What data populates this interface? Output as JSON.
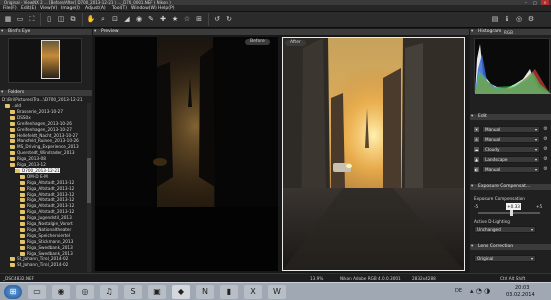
{
  "window": {
    "title": "Original - ViewNX 2 ...   [Before/After]  D700_2013-12-21 \\ ..._D70_0001.NEF  ( Nikon )"
  },
  "menu": {
    "items": [
      "File(F)",
      "Edit(E)",
      "View(V)",
      "Image(I)",
      "Adjust(A)",
      "Tool(T)",
      "Window(W)",
      "Help(P)"
    ]
  },
  "left": {
    "birds_eye_title": "Bird's Eye",
    "folders_title": "Folders",
    "path": "D:\\Bri\\Pictures\\Tra...\\D700_2013-12-21",
    "tree": [
      {
        "label": "..old",
        "indent": 1
      },
      {
        "label": "Brasserie_2013-10-27",
        "indent": 2
      },
      {
        "label": "DSS0x",
        "indent": 2
      },
      {
        "label": "Greifenhagen_2013-10-26",
        "indent": 2
      },
      {
        "label": "Greifenhagen_2013-10-27",
        "indent": 2
      },
      {
        "label": "Hellefeldt_Nacht_2013-10-27",
        "indent": 2
      },
      {
        "label": "Mansfeld_Ruinen_2013-10-26",
        "indent": 2
      },
      {
        "label": "MS_Driving_Experience_2013",
        "indent": 2
      },
      {
        "label": "Querstedt_Windrader_2013",
        "indent": 2
      },
      {
        "label": "Riga_2013-08",
        "indent": 2
      },
      {
        "label": "Riga_2013-12",
        "indent": 2
      },
      {
        "label": "D700_2013-12-21",
        "indent": 3,
        "selected": true
      },
      {
        "label": "OM-D E-M",
        "indent": 4
      },
      {
        "label": "Riga_Altstadt_2013-12",
        "indent": 4
      },
      {
        "label": "Riga_Altstadt_2013-12",
        "indent": 4
      },
      {
        "label": "Riga_Altstadt_2013-12",
        "indent": 4
      },
      {
        "label": "Riga_Altstadt_2013-12",
        "indent": 4
      },
      {
        "label": "Riga_Altstadt_2013-12",
        "indent": 4
      },
      {
        "label": "Riga_Altstadt_2013-12",
        "indent": 4
      },
      {
        "label": "Riga_Jugendstil_2013",
        "indent": 4
      },
      {
        "label": "Riga_Nostalgie_Vorort",
        "indent": 4
      },
      {
        "label": "Riga_Nationaltheater",
        "indent": 4
      },
      {
        "label": "Riga_Speicherviertel",
        "indent": 4
      },
      {
        "label": "Riga_Stickmann_2013",
        "indent": 4
      },
      {
        "label": "Riga_Swedbank_2013",
        "indent": 4
      },
      {
        "label": "Riga_Swedbank_2013",
        "indent": 4
      },
      {
        "label": "St_Johann_Tirol_2014-02",
        "indent": 2
      },
      {
        "label": "St_Johann_Tirol_2014-02",
        "indent": 2
      }
    ]
  },
  "preview": {
    "title": "Preview",
    "before_label": "Before",
    "after_label": "After"
  },
  "right": {
    "histogram_title": "Histogram",
    "histogram_mode": "RGB",
    "edit_title": "Edit",
    "presets": [
      {
        "icon": "wb",
        "label": "Manual"
      },
      {
        "icon": "exp",
        "label": "Manual"
      },
      {
        "icon": "pic",
        "label": "Cloudy"
      },
      {
        "icon": "pc",
        "label": "Landscape"
      },
      {
        "icon": "cs",
        "label": "Manual"
      }
    ],
    "exposure_section": "Exposure Compensat...",
    "exposure_label": "Exposure Compensation",
    "exposure_min": "-5",
    "exposure_max": "+5",
    "exposure_value": "+0.33",
    "exposure_level_fraction": 0.53,
    "adl_label": "Active D-Lighting",
    "adl_value": "Unchanged",
    "lens_section": "Lens Correction",
    "lens_value": "Original"
  },
  "status": {
    "filename": "_DSC4832.NEF",
    "zoom": "13.9%",
    "profile": "Nikon Adobe RGB 4.0.0.3001",
    "size": "2832x4288",
    "hints": "Ctrl  Alt  Shift"
  },
  "taskbar": {
    "icons": [
      "windows-start-icon",
      "files-icon",
      "firefox-icon",
      "chrome-icon",
      "itunes-icon",
      "skype-icon",
      "photo-icon",
      "viewnx-icon",
      "nikon-icon",
      "terminal-icon",
      "excel-icon",
      "word-icon"
    ],
    "lang": "DE",
    "time": "20:03",
    "date": "03.02.2014"
  },
  "colors": {
    "accent": "#f5c25a",
    "panel": "#202020",
    "header": "#3b3b3b"
  }
}
